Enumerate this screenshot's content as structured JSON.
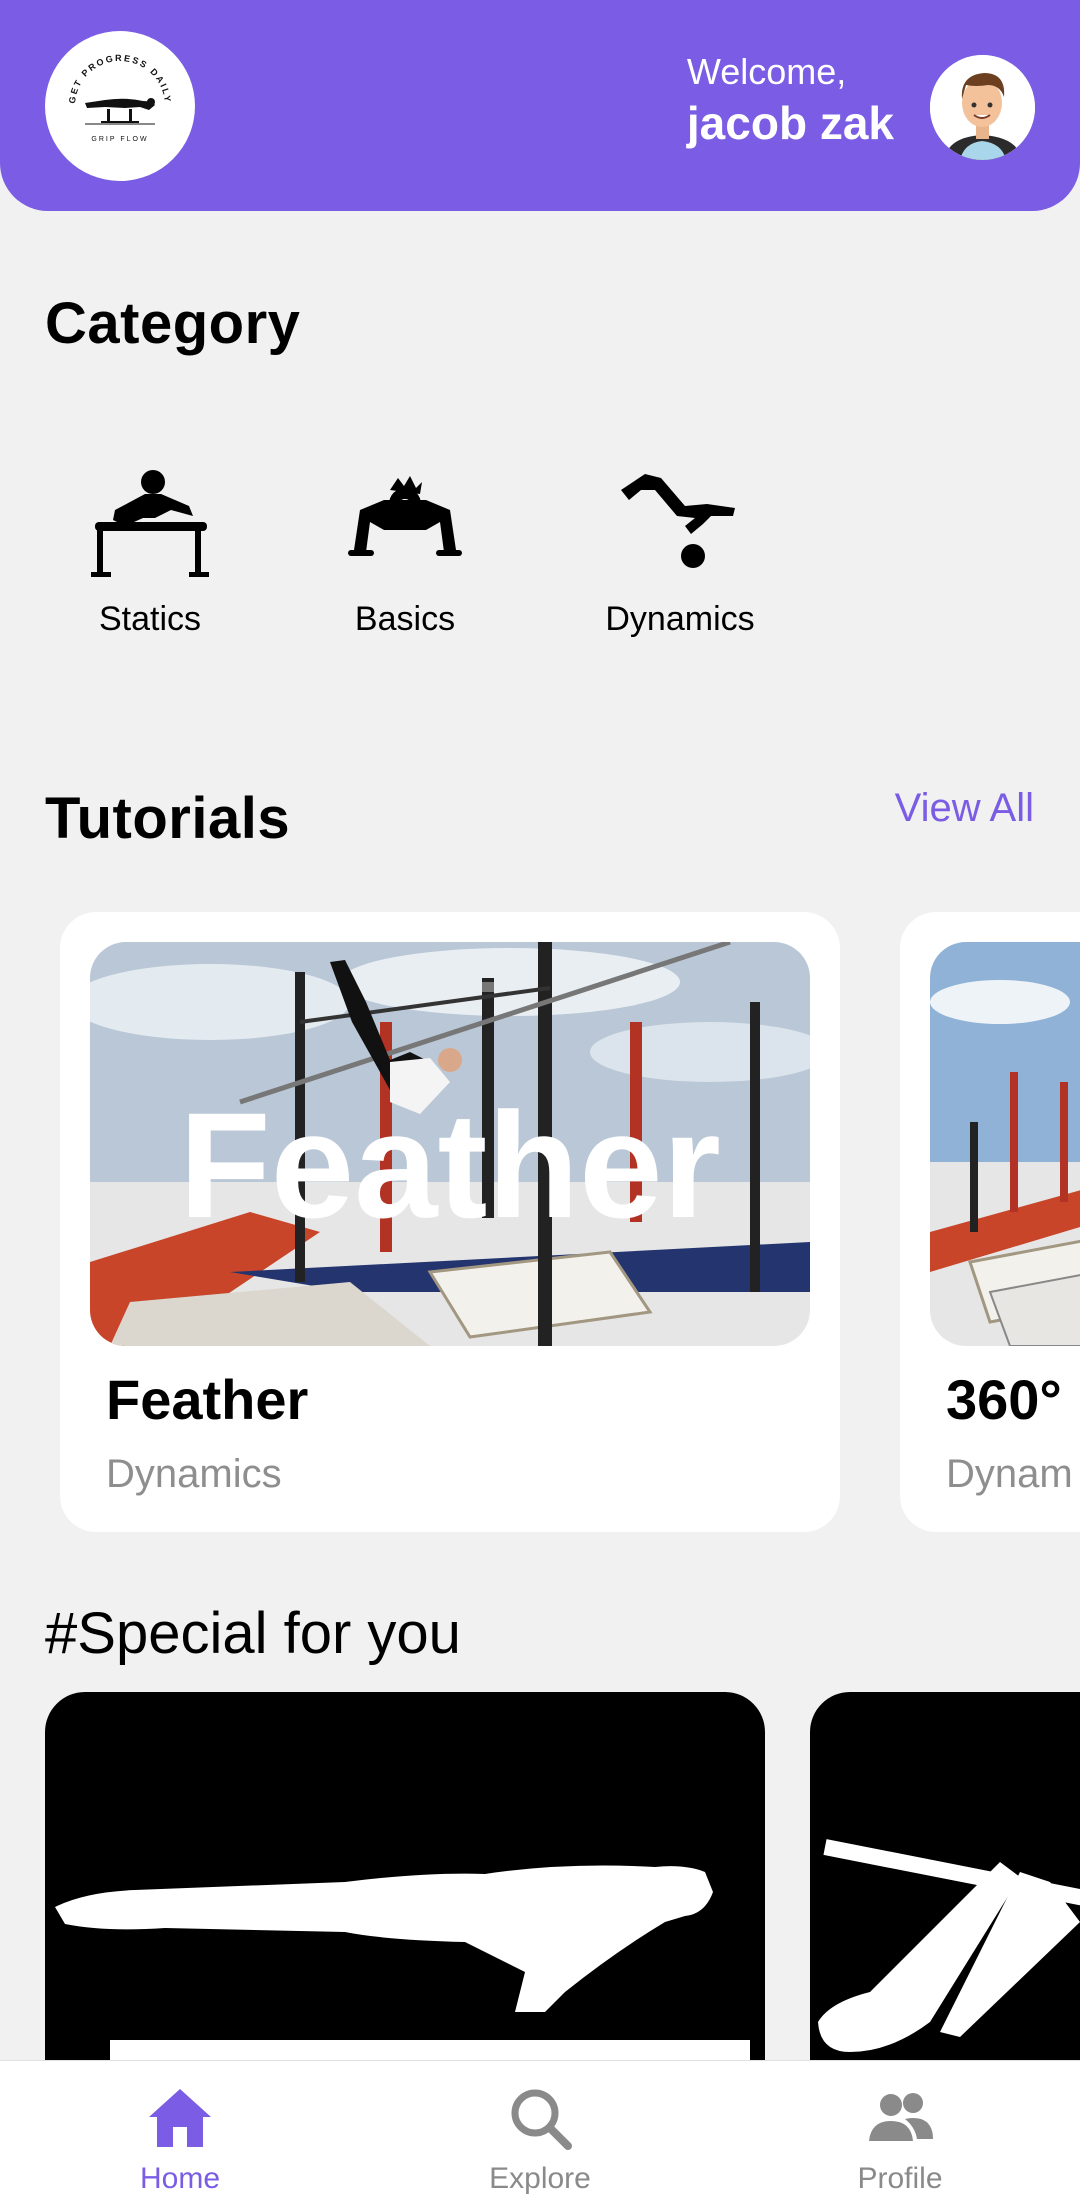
{
  "header": {
    "logo_text_top": "GET PROGRESS DAILY",
    "logo_text_bottom": "GRIP FLOW",
    "welcome_label": "Welcome,",
    "user_name": "jacob zak",
    "accent_color": "#7b5ce4"
  },
  "category": {
    "title": "Category",
    "items": [
      {
        "label": "Statics",
        "icon": "statics-icon"
      },
      {
        "label": "Basics",
        "icon": "basics-icon"
      },
      {
        "label": "Dynamics",
        "icon": "dynamics-icon"
      }
    ]
  },
  "tutorials": {
    "title": "Tutorials",
    "view_all": "View All",
    "cards": [
      {
        "image_text": "Feather",
        "title": "Feather",
        "subtitle": "Dynamics"
      },
      {
        "title": "360°",
        "subtitle": "Dynam"
      }
    ]
  },
  "special": {
    "title": "#Special for you"
  },
  "nav": {
    "items": [
      {
        "label": "Home",
        "icon": "home-icon",
        "active": true
      },
      {
        "label": "Explore",
        "icon": "search-icon",
        "active": false
      },
      {
        "label": "Profile",
        "icon": "profile-icon",
        "active": false
      }
    ],
    "active_color": "#7b5ce4",
    "inactive_color": "#8a8a8a"
  }
}
